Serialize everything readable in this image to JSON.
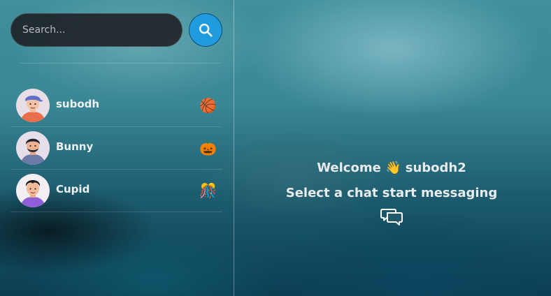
{
  "search": {
    "placeholder": "Search..."
  },
  "contacts": [
    {
      "name": "subodh",
      "emoji": "🏀",
      "avatar": "avatar-boy-cap"
    },
    {
      "name": "Bunny",
      "emoji": "🎃",
      "avatar": "avatar-boy-beard"
    },
    {
      "name": "Cupid",
      "emoji": "🎊",
      "avatar": "avatar-boy-purple"
    }
  ],
  "welcome": {
    "greeting": "Welcome 👋 subodh2",
    "prompt": "Select a chat start messaging",
    "icon": "chat-bubbles-icon"
  },
  "colors": {
    "accent": "#1f9be0",
    "search_bg": "#1c1e22"
  }
}
